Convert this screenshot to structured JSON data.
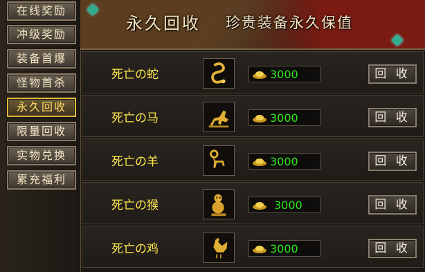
{
  "sidebar": {
    "items": [
      {
        "label": "在线奖励"
      },
      {
        "label": "冲级奖励"
      },
      {
        "label": "装备首爆"
      },
      {
        "label": "怪物首杀"
      },
      {
        "label": "永久回收"
      },
      {
        "label": "限量回收"
      },
      {
        "label": "实物兑换"
      },
      {
        "label": "累充福利"
      }
    ],
    "active_index": 4
  },
  "banner": {
    "title": "永久回收",
    "subtitle": "珍贵装备永久保值"
  },
  "items": [
    {
      "name": "死亡の蛇",
      "icon": "gold-snake-icon",
      "price": "3000",
      "button": "回 收"
    },
    {
      "name": "死亡の马",
      "icon": "gold-horse-icon",
      "price": "3000",
      "button": "回 收"
    },
    {
      "name": "死亡の羊",
      "icon": "gold-goat-icon",
      "price": "3000",
      "button": "回 收"
    },
    {
      "name": "死亡の猴",
      "icon": "gold-monkey-icon",
      "price": "3000",
      "button": "回 收"
    },
    {
      "name": "死亡の鸡",
      "icon": "gold-rooster-icon",
      "price": "3000",
      "button": "回 收"
    }
  ],
  "colors": {
    "item_name": "#ffe84c",
    "price": "#2ee91e",
    "active_nav": "#e2b93b"
  }
}
